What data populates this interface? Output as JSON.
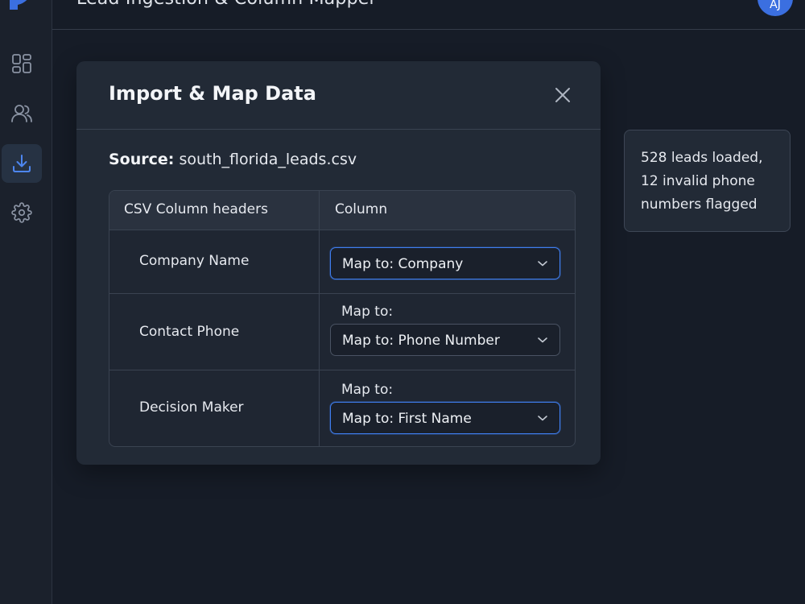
{
  "app": {
    "title": "Lead Ingestion & Column Mapper",
    "avatar_initials": "AJ",
    "accent_color": "#3b6fe0"
  },
  "sidebar": {
    "items": [
      {
        "icon": "dashboard-icon",
        "active": false
      },
      {
        "icon": "users-icon",
        "active": false
      },
      {
        "icon": "download-icon",
        "active": true
      },
      {
        "icon": "gear-icon",
        "active": false
      }
    ]
  },
  "modal": {
    "title": "Import & Map Data",
    "source_label": "Source:",
    "source_file": "south_florida_leads.csv",
    "table": {
      "headers": [
        "CSV Column headers",
        "Column"
      ],
      "rows": [
        {
          "csv_header": "Company Name",
          "caption": "",
          "mapping": "Map to: Company",
          "focused": true
        },
        {
          "csv_header": "Contact Phone",
          "caption": "Map to:",
          "mapping": "Map to: Phone Number",
          "focused": false
        },
        {
          "csv_header": "Decision Maker",
          "caption": "Map to:",
          "mapping": "Map to: First Name",
          "focused": true
        }
      ]
    }
  },
  "status_toast": {
    "lines": [
      "528 leads loaded,",
      "12 invalid phone",
      "numbers flagged"
    ]
  }
}
